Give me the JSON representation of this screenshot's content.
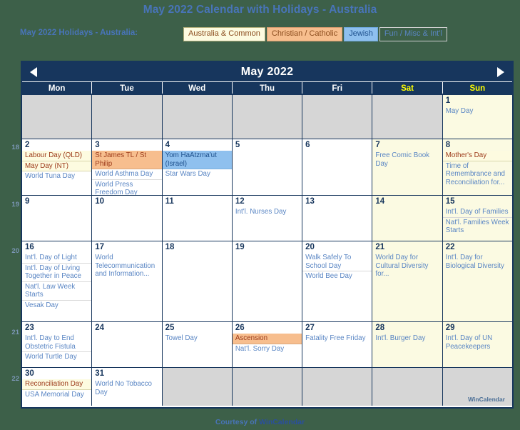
{
  "page": {
    "title": "May 2022 Calendar with Holidays - Australia",
    "legend_label": "May 2022 Holidays - Australia:",
    "background_color": "#3d6049",
    "accent_color": "#17365d",
    "link_color": "#4874b8"
  },
  "legend": {
    "chips": [
      {
        "label": "Australia & Common",
        "bg": "#fdfbe0",
        "fg": "#8a4b1c"
      },
      {
        "label": "Christian / Catholic",
        "bg": "#f7be8e",
        "fg": "#8a4b1c"
      },
      {
        "label": "Jewish",
        "bg": "#8fc0ee",
        "fg": "#1d4f8c"
      },
      {
        "label": "Fun / Misc & Int'l",
        "bg": "#3d6049",
        "fg": "#5a86c4"
      }
    ]
  },
  "calendar": {
    "month_title": "May 2022",
    "prev_label": "Previous month",
    "next_label": "Next month",
    "watermark": "WinCalendar",
    "day_headers": [
      {
        "label": "Mon",
        "weekend": false
      },
      {
        "label": "Tue",
        "weekend": false
      },
      {
        "label": "Wed",
        "weekend": false
      },
      {
        "label": "Thu",
        "weekend": false
      },
      {
        "label": "Fri",
        "weekend": false
      },
      {
        "label": "Sat",
        "weekend": true
      },
      {
        "label": "Sun",
        "weekend": true
      }
    ],
    "week_numbers": [
      "",
      "18",
      "19",
      "20",
      "21",
      "22"
    ],
    "weeks": [
      {
        "height_class": "h1",
        "days": [
          {
            "num": "",
            "blank": true,
            "events": []
          },
          {
            "num": "",
            "blank": true,
            "events": []
          },
          {
            "num": "",
            "blank": true,
            "events": []
          },
          {
            "num": "",
            "blank": true,
            "events": []
          },
          {
            "num": "",
            "blank": true,
            "events": []
          },
          {
            "num": "",
            "blank": true,
            "weekend": true,
            "events": []
          },
          {
            "num": "1",
            "weekend": true,
            "events": [
              {
                "text": "May Day",
                "cat": "fun"
              }
            ]
          }
        ]
      },
      {
        "height_class": "h2",
        "days": [
          {
            "num": "2",
            "events": [
              {
                "text": "Labour Day (QLD)",
                "cat": "common"
              },
              {
                "text": "May Day (NT)",
                "cat": "common"
              },
              {
                "text": "World Tuna Day",
                "cat": "fun"
              }
            ]
          },
          {
            "num": "3",
            "events": [
              {
                "text": "St James TL / St Philip",
                "cat": "christian"
              },
              {
                "text": "World Asthma Day",
                "cat": "fun"
              },
              {
                "text": "World Press Freedom Day",
                "cat": "fun"
              }
            ]
          },
          {
            "num": "4",
            "events": [
              {
                "text": "Yom HaAtzma'ut (Israel)",
                "cat": "jewish"
              },
              {
                "text": "Star Wars Day",
                "cat": "fun"
              }
            ]
          },
          {
            "num": "5",
            "events": []
          },
          {
            "num": "6",
            "events": []
          },
          {
            "num": "7",
            "weekend": true,
            "events": [
              {
                "text": "Free Comic Book Day",
                "cat": "fun"
              }
            ]
          },
          {
            "num": "8",
            "weekend": true,
            "events": [
              {
                "text": "Mother's Day",
                "cat": "common"
              },
              {
                "text": "Time of Remembrance and Reconciliation for...",
                "cat": "fun"
              }
            ]
          }
        ]
      },
      {
        "height_class": "h3",
        "days": [
          {
            "num": "9",
            "events": []
          },
          {
            "num": "10",
            "events": []
          },
          {
            "num": "11",
            "events": []
          },
          {
            "num": "12",
            "events": [
              {
                "text": "Int'l. Nurses Day",
                "cat": "fun"
              }
            ]
          },
          {
            "num": "13",
            "events": []
          },
          {
            "num": "14",
            "weekend": true,
            "events": []
          },
          {
            "num": "15",
            "weekend": true,
            "events": [
              {
                "text": "Int'l. Day of Families",
                "cat": "fun"
              },
              {
                "text": "Nat'l. Families Week Starts",
                "cat": "fun"
              }
            ]
          }
        ]
      },
      {
        "height_class": "h4",
        "days": [
          {
            "num": "16",
            "events": [
              {
                "text": "Int'l. Day of Light",
                "cat": "fun"
              },
              {
                "text": "Int'l. Day of Living Together in Peace",
                "cat": "fun"
              },
              {
                "text": "Nat'l. Law Week Starts",
                "cat": "fun"
              },
              {
                "text": "Vesak Day",
                "cat": "fun"
              }
            ]
          },
          {
            "num": "17",
            "events": [
              {
                "text": "World Telecommunication and Information...",
                "cat": "fun"
              }
            ]
          },
          {
            "num": "18",
            "events": []
          },
          {
            "num": "19",
            "events": []
          },
          {
            "num": "20",
            "events": [
              {
                "text": "Walk Safely To School Day",
                "cat": "fun"
              },
              {
                "text": "World Bee Day",
                "cat": "fun"
              }
            ]
          },
          {
            "num": "21",
            "weekend": true,
            "events": [
              {
                "text": "World Day for Cultural Diversity for...",
                "cat": "fun"
              }
            ]
          },
          {
            "num": "22",
            "weekend": true,
            "events": [
              {
                "text": "Int'l. Day for Biological Diversity",
                "cat": "fun"
              }
            ]
          }
        ]
      },
      {
        "height_class": "h5",
        "days": [
          {
            "num": "23",
            "events": [
              {
                "text": "Int'l. Day to End Obstetric Fistula",
                "cat": "fun"
              },
              {
                "text": "World Turtle Day",
                "cat": "fun"
              }
            ]
          },
          {
            "num": "24",
            "events": []
          },
          {
            "num": "25",
            "events": [
              {
                "text": "Towel Day",
                "cat": "fun"
              }
            ]
          },
          {
            "num": "26",
            "events": [
              {
                "text": "Ascension",
                "cat": "christian"
              },
              {
                "text": "Nat'l. Sorry Day",
                "cat": "fun"
              }
            ]
          },
          {
            "num": "27",
            "events": [
              {
                "text": "Fatality Free Friday",
                "cat": "fun"
              }
            ]
          },
          {
            "num": "28",
            "weekend": true,
            "events": [
              {
                "text": "Int'l. Burger Day",
                "cat": "fun"
              }
            ]
          },
          {
            "num": "29",
            "weekend": true,
            "events": [
              {
                "text": "Int'l. Day of UN Peacekeepers",
                "cat": "fun"
              }
            ]
          }
        ]
      },
      {
        "height_class": "h6",
        "days": [
          {
            "num": "30",
            "events": [
              {
                "text": "Reconciliation Day",
                "cat": "common"
              },
              {
                "text": "USA Memorial Day",
                "cat": "fun"
              }
            ]
          },
          {
            "num": "31",
            "events": [
              {
                "text": "World No Tobacco Day",
                "cat": "fun"
              }
            ]
          },
          {
            "num": "",
            "blank": true,
            "events": []
          },
          {
            "num": "",
            "blank": true,
            "events": []
          },
          {
            "num": "",
            "blank": true,
            "events": []
          },
          {
            "num": "",
            "blank": true,
            "events": []
          },
          {
            "num": "",
            "blank": true,
            "events": []
          }
        ]
      }
    ]
  },
  "footer": {
    "prefix": "Courtesy of ",
    "brand": "WinCalendar"
  }
}
